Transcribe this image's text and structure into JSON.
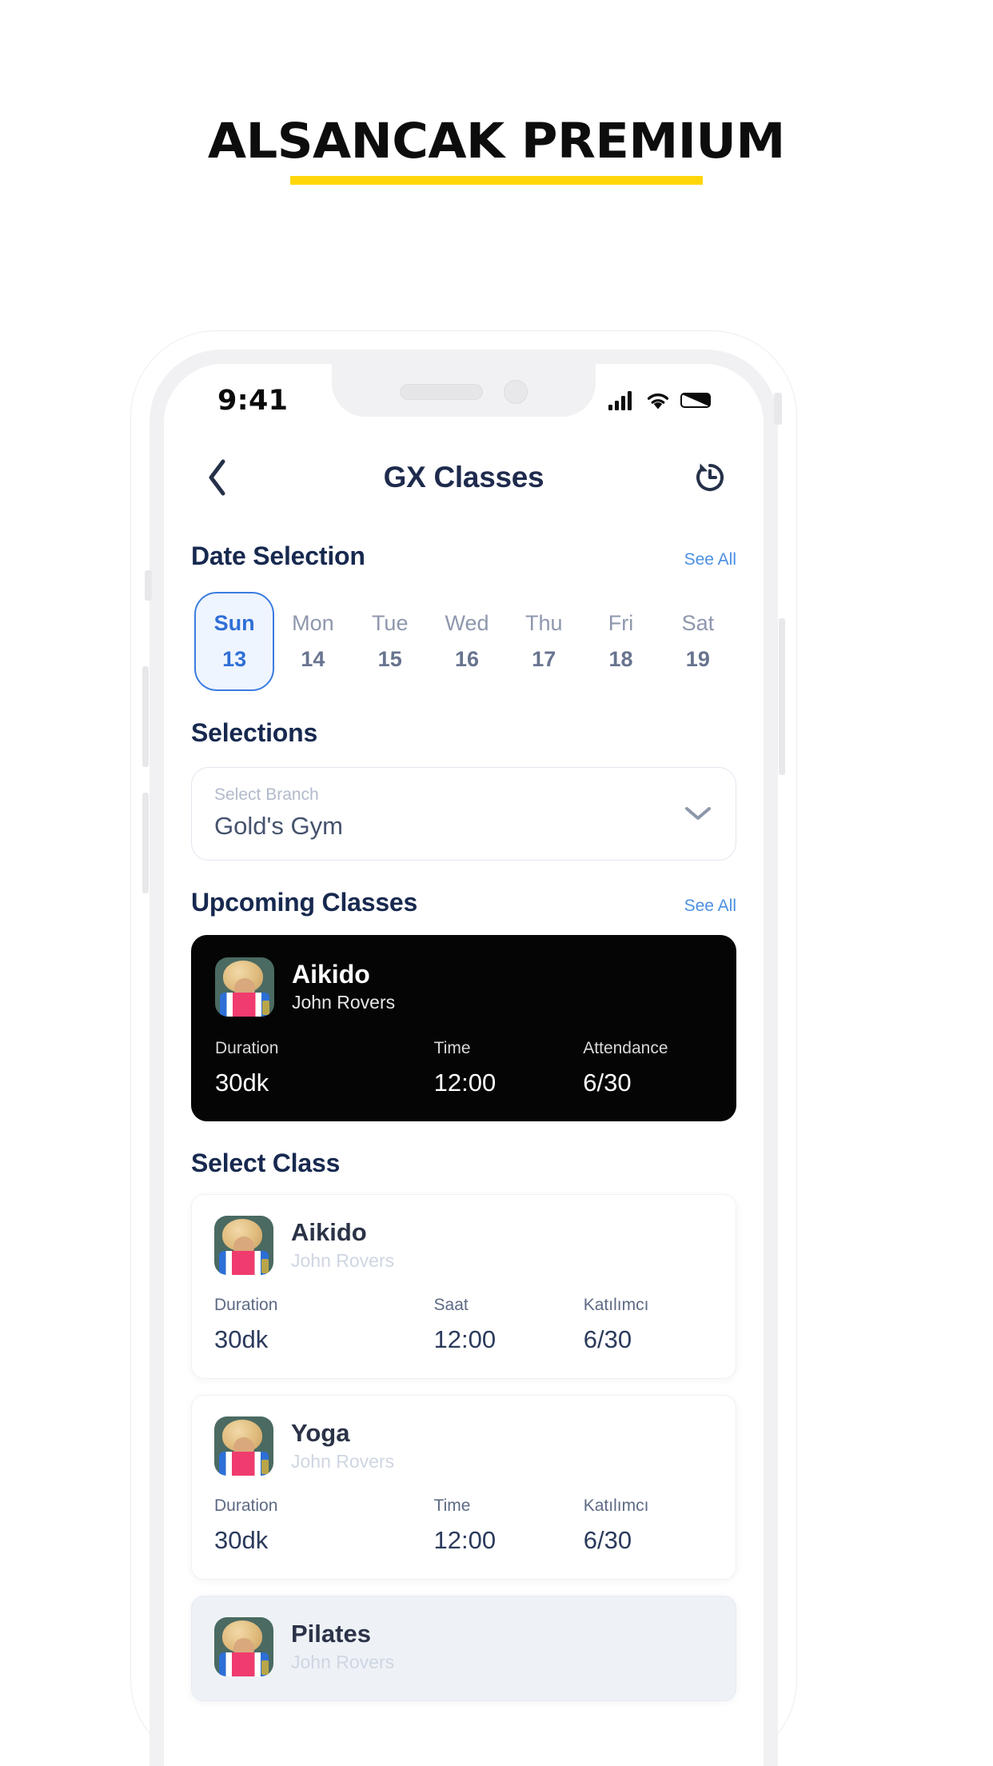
{
  "brand": {
    "title": "ALSANCAK PREMIUM",
    "underline_color": "#FFD60A"
  },
  "status_bar": {
    "time": "9:41",
    "icons": [
      "signal-icon",
      "wifi-icon",
      "battery-icon"
    ]
  },
  "navbar": {
    "back_icon": "chevron-left-icon",
    "title": "GX Classes",
    "history_icon": "history-icon"
  },
  "date_selection": {
    "title": "Date Selection",
    "see_all": "See All",
    "days": [
      {
        "dow": "Sun",
        "num": "13",
        "selected": true
      },
      {
        "dow": "Mon",
        "num": "14",
        "selected": false
      },
      {
        "dow": "Tue",
        "num": "15",
        "selected": false
      },
      {
        "dow": "Wed",
        "num": "16",
        "selected": false
      },
      {
        "dow": "Thu",
        "num": "17",
        "selected": false
      },
      {
        "dow": "Fri",
        "num": "18",
        "selected": false
      },
      {
        "dow": "Sat",
        "num": "19",
        "selected": false
      }
    ]
  },
  "selections": {
    "title": "Selections",
    "branch": {
      "label": "Select Branch",
      "value": "Gold's Gym",
      "chevron": "chevron-down-icon"
    }
  },
  "upcoming": {
    "title": "Upcoming Classes",
    "see_all": "See All",
    "card": {
      "name": "Aikido",
      "instructor": "John Rovers",
      "stats": [
        {
          "key": "Duration",
          "value": "30dk"
        },
        {
          "key": "Time",
          "value": "12:00"
        },
        {
          "key": "Attendance",
          "value": "6/30"
        }
      ]
    }
  },
  "select_class": {
    "title": "Select Class",
    "cards": [
      {
        "name": "Aikido",
        "instructor": "John Rovers",
        "tinted": false,
        "stats": [
          {
            "key": "Duration",
            "value": "30dk"
          },
          {
            "key": "Saat",
            "value": "12:00"
          },
          {
            "key": "Katılımcı",
            "value": "6/30"
          }
        ]
      },
      {
        "name": "Yoga",
        "instructor": "John Rovers",
        "tinted": false,
        "stats": [
          {
            "key": "Duration",
            "value": "30dk"
          },
          {
            "key": "Time",
            "value": "12:00"
          },
          {
            "key": "Katılımcı",
            "value": "6/30"
          }
        ]
      },
      {
        "name": "Pilates",
        "instructor": "John Rovers",
        "tinted": true,
        "stats": []
      }
    ]
  },
  "colors": {
    "accent_blue": "#3a7ce0",
    "link_blue": "#4A90E2",
    "heading_navy": "#17294f",
    "brand_yellow": "#FFD60A",
    "card_black": "#050505"
  }
}
